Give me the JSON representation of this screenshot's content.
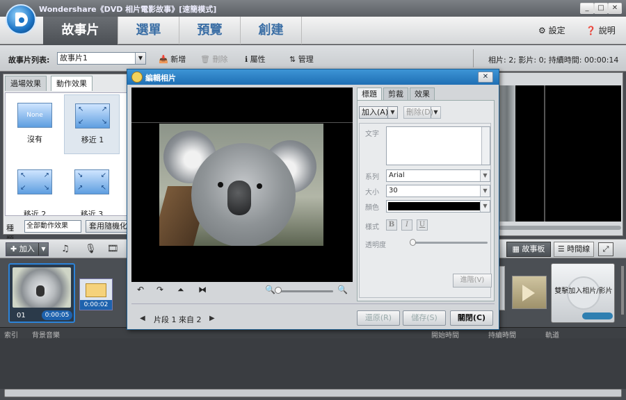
{
  "window": {
    "title": "Wondershare《DVD 相片電影故事》[速簡模式]",
    "min": "_",
    "max": "□",
    "close": "✕"
  },
  "main_tabs": [
    {
      "label": "故事片"
    },
    {
      "label": "選單"
    },
    {
      "label": "預覽"
    },
    {
      "label": "創建"
    }
  ],
  "top_links": {
    "settings": "⚙ 設定",
    "help": "❓ 說明"
  },
  "story_bar": {
    "label": "故事片列表:",
    "selected": "故事片1",
    "new": "📥 新增",
    "delete": "🗑 刪除",
    "properties": "ℹ 屬性",
    "manage": "⇅ 管理",
    "stats": "相片: 2; 影片: 0; 持續時間: 00:00:14"
  },
  "effects": {
    "tabs": [
      "過場效果",
      "動作效果"
    ],
    "items": [
      {
        "label": "沒有",
        "thumb": "None"
      },
      {
        "label": "移近 1",
        "thumb": ""
      },
      {
        "label": "移近 2",
        "thumb": ""
      },
      {
        "label": "移近 3",
        "thumb": ""
      }
    ],
    "kind_label": "種類",
    "kind_value": "全部動作效果",
    "random_button": "套用隨機化到"
  },
  "timeline_toolbar": {
    "add": "✚ 加入",
    "storyboard": "▦ 故事板",
    "timeline": "☰ 時間線"
  },
  "storyboard": {
    "clip1": {
      "index": "01",
      "duration": "0:00:05"
    },
    "clip2": {
      "duration": "0:00:02"
    },
    "add_slot": "雙擊加入相片/影片"
  },
  "bottom_columns": {
    "index": "索引",
    "music": "背景音樂",
    "start": "開始時間",
    "duration": "持續時間",
    "track": "軌道"
  },
  "dialog": {
    "title": "編輯相片",
    "close": "✕",
    "tabs": [
      "標題",
      "剪裁",
      "效果"
    ],
    "add": "加入(A)",
    "delete": "刪除(D)",
    "text_label": "文字",
    "family_label": "系列",
    "family_value": "Arial",
    "size_label": "大小",
    "size_value": "30",
    "color_label": "顏色",
    "color_value": "#000000",
    "style_label": "樣式",
    "bold": "B",
    "italic": "I",
    "underline": "U",
    "opacity_label": "透明度",
    "advanced": "進階(V)",
    "segment": "片段 1 來自 2",
    "restore": "還原(R)",
    "save": "儲存(S)",
    "close_btn": "關閉(C)"
  }
}
